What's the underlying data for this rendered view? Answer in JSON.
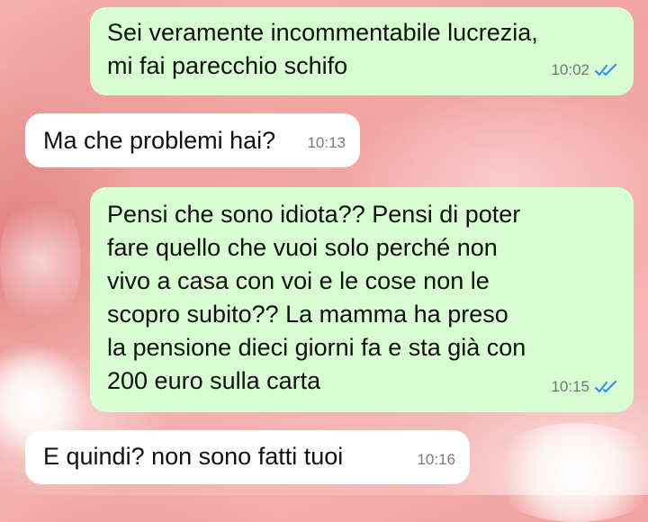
{
  "colors": {
    "outgoing_bubble": "#d9fdd3",
    "incoming_bubble": "#ffffff",
    "read_ticks": "#3b8fe8"
  },
  "messages": [
    {
      "direction": "outgoing",
      "text": "Sei veramente incommentabile lucrezia,\nmi fai parecchio schifo",
      "time": "10:02",
      "status_icon": "double-check-read-icon"
    },
    {
      "direction": "incoming",
      "text": "Ma che problemi hai?",
      "time": "10:13"
    },
    {
      "direction": "outgoing",
      "text": "Pensi che sono idiota?? Pensi di poter\nfare quello che vuoi solo perché non\nvivo a casa con voi e le cose non le\nscopro subito?? La mamma ha preso\nla pensione dieci giorni fa e sta già con\n200 euro sulla carta",
      "time": "10:15",
      "status_icon": "double-check-read-icon"
    },
    {
      "direction": "incoming",
      "text": "E quindi? non sono fatti tuoi",
      "time": "10:16"
    }
  ]
}
